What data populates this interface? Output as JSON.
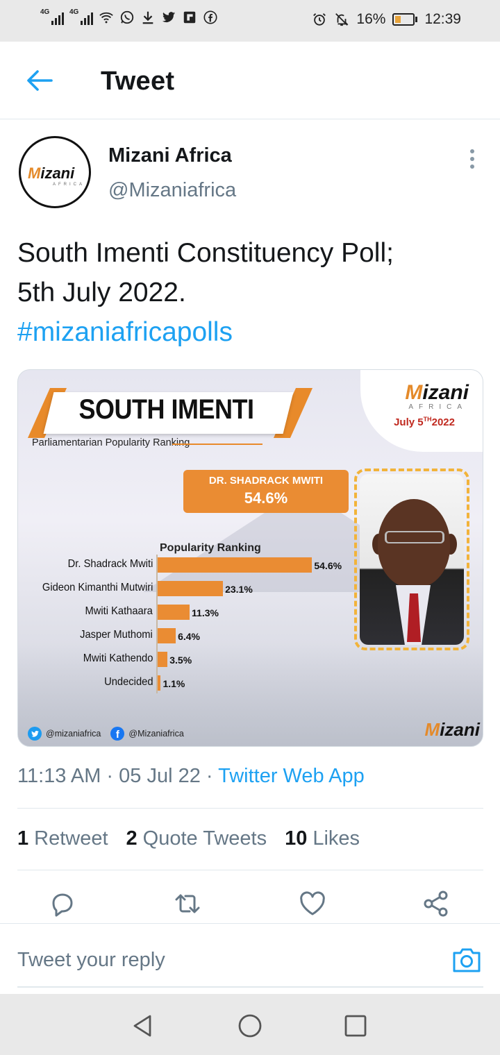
{
  "status_bar": {
    "network_1": "4G",
    "network_2": "4G",
    "battery": "16%",
    "time": "12:39",
    "icons": [
      "wifi-icon",
      "whatsapp-icon",
      "download-icon",
      "twitter-icon",
      "flipboard-icon",
      "facebook-icon",
      "alarm-icon",
      "mute-icon"
    ]
  },
  "header": {
    "title": "Tweet",
    "back_icon": "arrow-left-icon"
  },
  "tweet": {
    "author_name": "Mizani Africa",
    "author_handle": "@Mizaniafrica",
    "avatar_logo": "Mizani",
    "avatar_sub": "AFRICA",
    "text_line1": "South Imenti Constituency Poll;",
    "text_line2": "5th July 2022.",
    "hashtag": "#mizaniafricapolls",
    "timestamp": "11:13 AM · 05 Jul 22 · ",
    "source": "Twitter Web App",
    "retweets_count": "1",
    "retweets_label": "Retweet",
    "quotes_count": "2",
    "quotes_label": "Quote Tweets",
    "likes_count": "10",
    "likes_label": "Likes"
  },
  "media": {
    "title": "SOUTH IMENTI",
    "subtitle": "Parliamentarian Popularity Ranking",
    "brand": "izani",
    "brand_sub": "AFRICA",
    "date_prefix": "July 5",
    "date_sup": "TH",
    "date_suffix": "2022",
    "winner_name": "DR. SHADRACK MWITI",
    "winner_pct": "54.6%",
    "twitter_handle": "@mizaniafrica",
    "facebook_handle": "@Mizaniafrica",
    "accent_color": "#ea8c33"
  },
  "chart_data": {
    "type": "bar",
    "orientation": "horizontal",
    "title": "Popularity Ranking",
    "categories": [
      "Dr. Shadrack Mwiti",
      "Gideon Kimanthi Mutwiri",
      "Mwiti Kathaara",
      "Jasper Muthomi",
      "Mwiti Kathendo",
      "Undecided"
    ],
    "values": [
      54.6,
      23.1,
      11.3,
      6.4,
      3.5,
      1.1
    ],
    "value_labels": [
      "54.6%",
      "23.1%",
      "11.3%",
      "6.4%",
      "3.5%",
      "1.1%"
    ],
    "xlim": [
      0,
      55
    ],
    "color": "#ea8c33"
  },
  "reply": {
    "placeholder": "Tweet your reply"
  },
  "colors": {
    "link": "#1da1f2",
    "muted": "#657786",
    "text": "#14171a"
  }
}
